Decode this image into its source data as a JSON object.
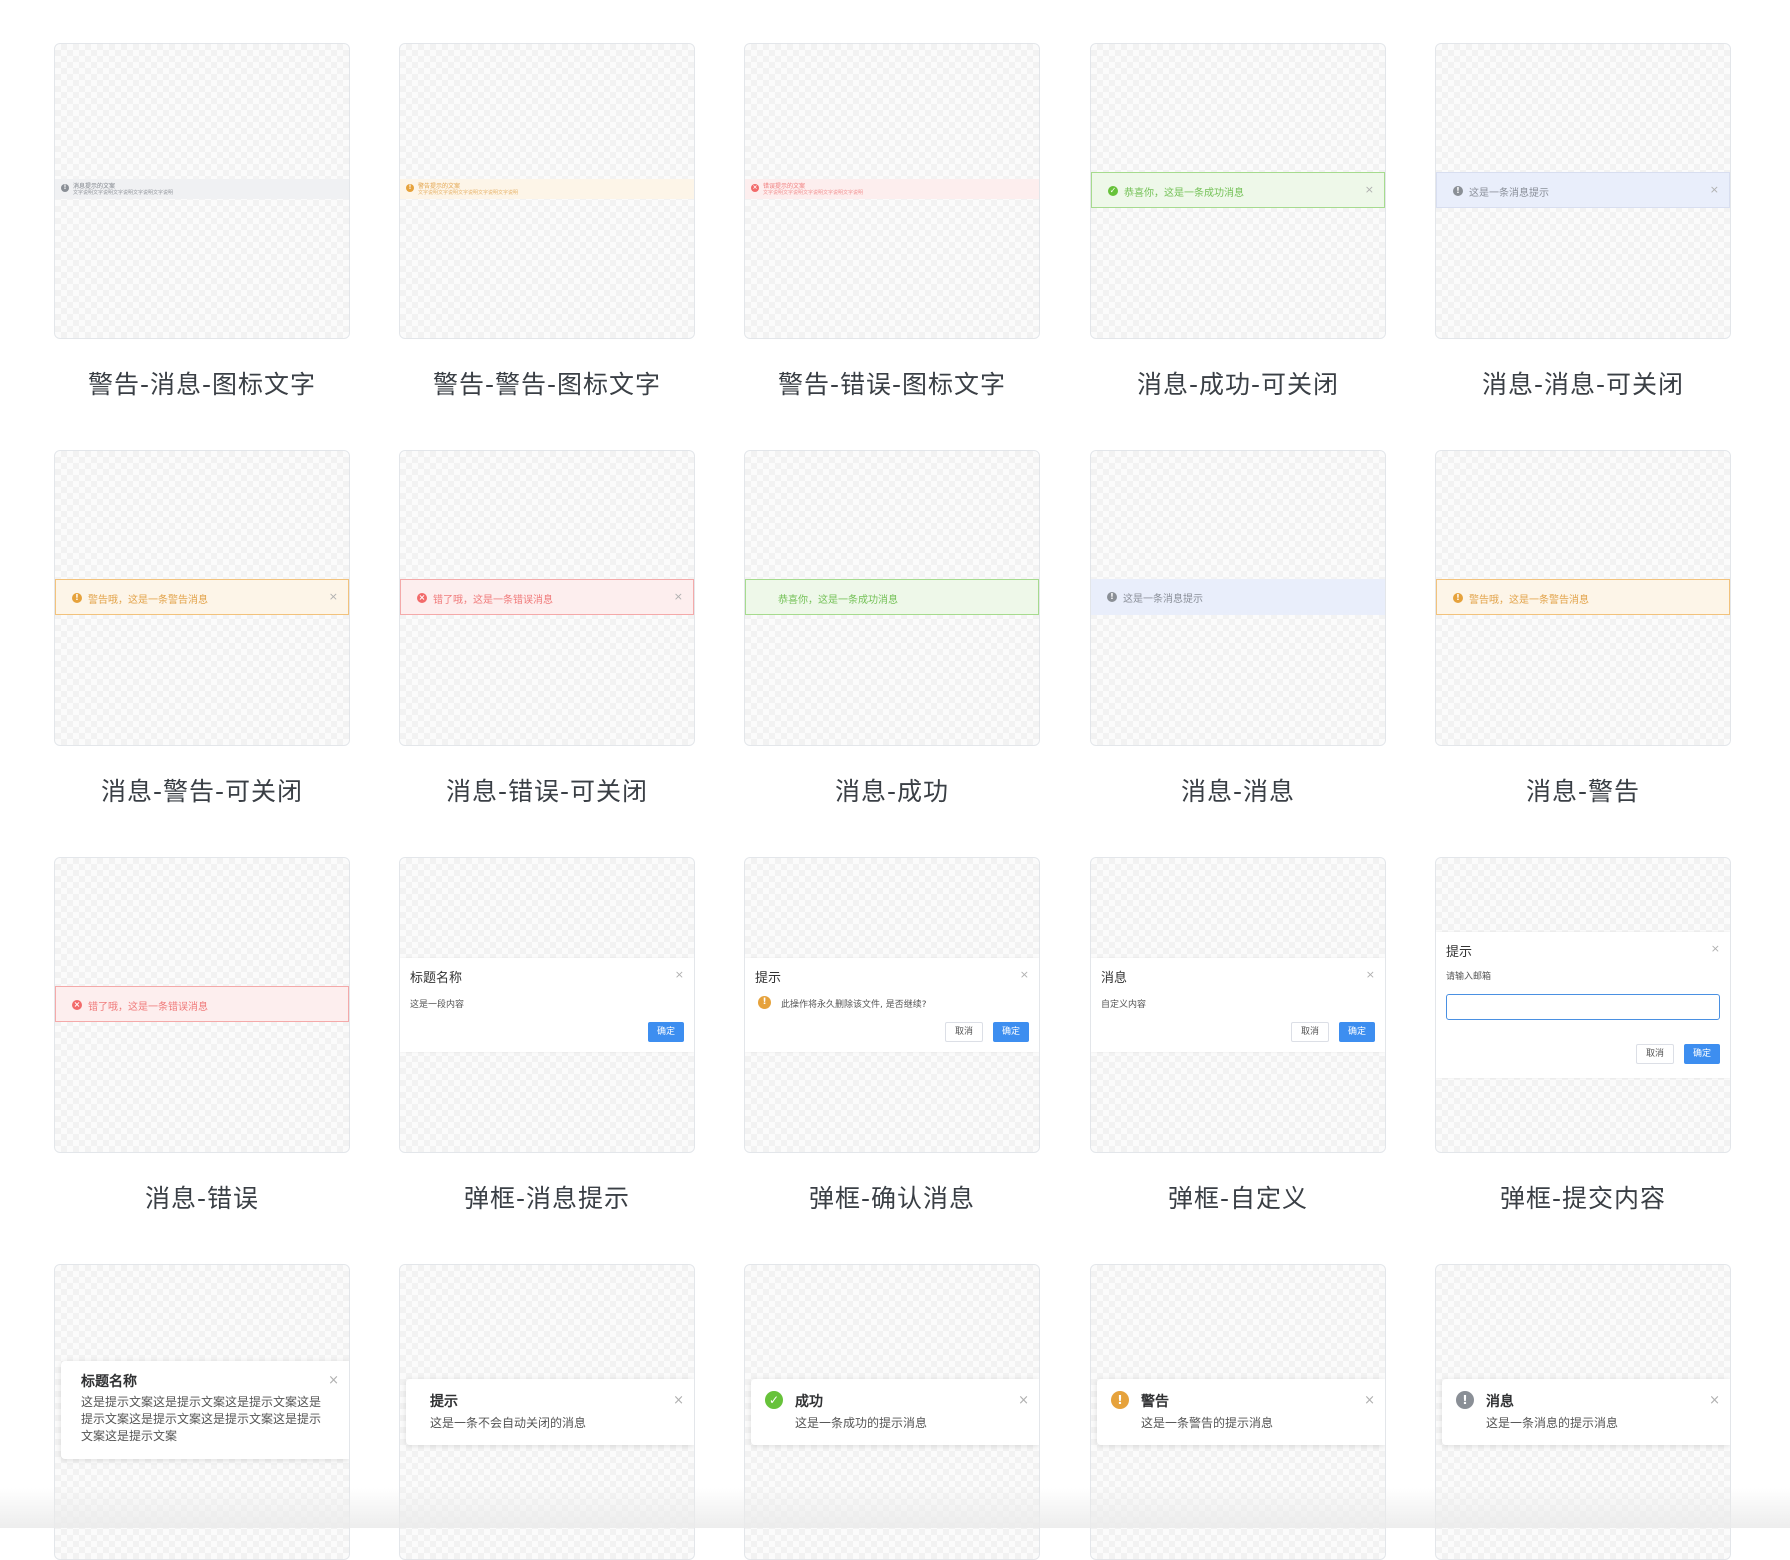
{
  "cards": [
    {
      "caption": "警告-消息-图标文字",
      "line1": "消息提示的文案",
      "line2": "文字说明文字说明文字说明文字说明文字说明",
      "icon": "info-icon"
    },
    {
      "caption": "警告-警告-图标文字",
      "line1": "警告提示的文案",
      "line2": "文字说明文字说明文字说明文字说明文字说明",
      "icon": "warning-icon"
    },
    {
      "caption": "警告-错误-图标文字",
      "line1": "错误提示的文案",
      "line2": "文字说明文字说明文字说明文字说明文字说明",
      "icon": "error-icon"
    },
    {
      "caption": "消息-成功-可关闭",
      "text": "恭喜你，这是一条成功消息",
      "close": "×",
      "icon": "success-icon"
    },
    {
      "caption": "消息-消息-可关闭",
      "text": "这是一条消息提示",
      "close": "×",
      "icon": "info-icon"
    },
    {
      "caption": "消息-警告-可关闭",
      "text": "警告哦，这是一条警告消息",
      "close": "×",
      "icon": "warning-icon"
    },
    {
      "caption": "消息-错误-可关闭",
      "text": "错了哦，这是一条错误消息",
      "close": "×",
      "icon": "error-icon"
    },
    {
      "caption": "消息-成功",
      "text": "恭喜你，这是一条成功消息"
    },
    {
      "caption": "消息-消息",
      "text": "这是一条消息提示",
      "icon": "info-icon"
    },
    {
      "caption": "消息-警告",
      "text": "警告哦，这是一条警告消息",
      "icon": "warning-icon"
    },
    {
      "caption": "消息-错误",
      "text": "错了哦，这是一条错误消息",
      "icon": "error-icon"
    },
    {
      "caption": "弹框-消息提示",
      "title": "标题名称",
      "body": "这是一段内容",
      "confirm": "确定",
      "close": "×"
    },
    {
      "caption": "弹框-确认消息",
      "title": "提示",
      "body": "此操作将永久删除该文件, 是否继续?",
      "cancel": "取消",
      "confirm": "确定",
      "close": "×"
    },
    {
      "caption": "弹框-自定义",
      "title": "消息",
      "body": "自定义内容",
      "cancel": "取消",
      "confirm": "确定",
      "close": "×"
    },
    {
      "caption": "弹框-提交内容",
      "title": "提示",
      "label": "请输入邮箱",
      "cancel": "取消",
      "confirm": "确定",
      "close": "×"
    },
    {
      "title": "标题名称",
      "body": "这是提示文案这是提示文案这是提示文案这是提示文案这是提示文案这是提示文案这是提示文案这是提示文案",
      "close": "×"
    },
    {
      "title": "提示",
      "body": "这是一条不会自动关闭的消息",
      "close": "×"
    },
    {
      "title": "成功",
      "body": "这是一条成功的提示消息",
      "close": "×",
      "icon": "success-icon"
    },
    {
      "title": "警告",
      "body": "这是一条警告的提示消息",
      "close": "×",
      "icon": "warning-icon"
    },
    {
      "title": "消息",
      "body": "这是一条消息的提示消息",
      "close": "×",
      "icon": "info-icon"
    }
  ],
  "colors": {
    "success": "#67c23a",
    "warning": "#e6a23c",
    "error": "#f56c6c",
    "info": "#909399",
    "primary": "#409eff"
  }
}
